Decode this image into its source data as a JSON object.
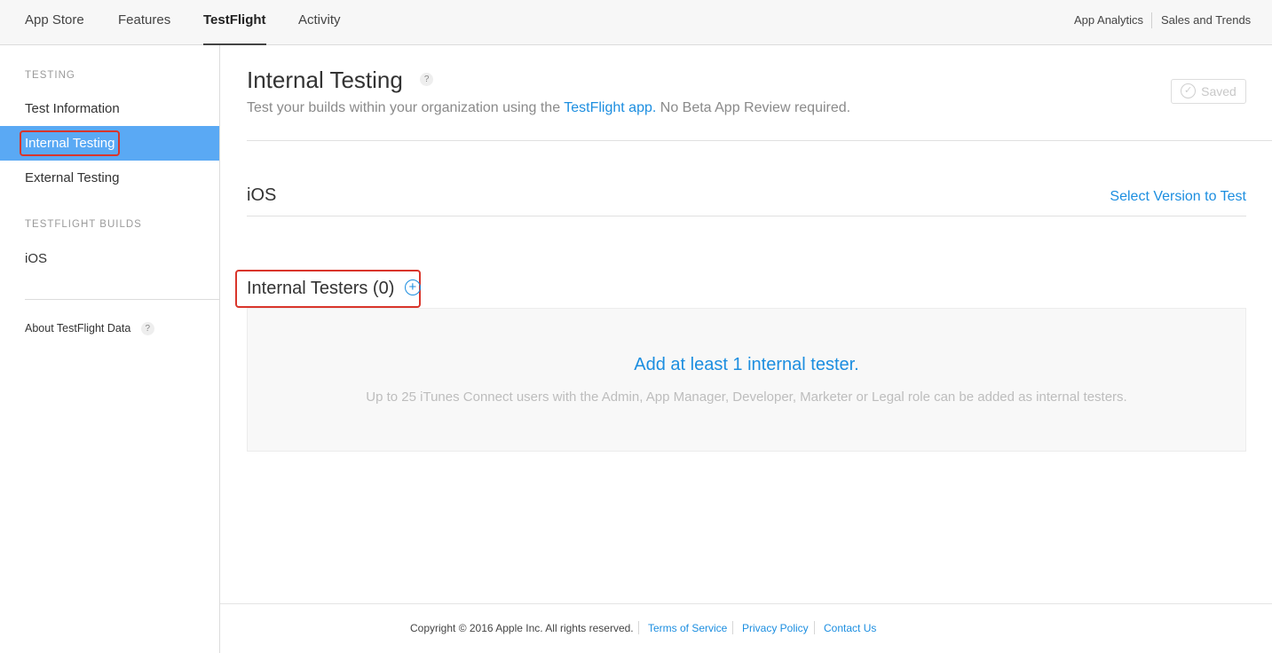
{
  "top_nav": {
    "tabs": [
      {
        "label": "App Store"
      },
      {
        "label": "Features"
      },
      {
        "label": "TestFlight",
        "active": true
      },
      {
        "label": "Activity"
      }
    ],
    "right_links": [
      {
        "label": "App Analytics"
      },
      {
        "label": "Sales and Trends"
      }
    ]
  },
  "sidebar": {
    "testing_header": "TESTING",
    "items": [
      {
        "label": "Test Information"
      },
      {
        "label": "Internal Testing",
        "active": true
      },
      {
        "label": "External Testing"
      }
    ],
    "builds_header": "TESTFLIGHT BUILDS",
    "build_items": [
      {
        "label": "iOS"
      }
    ],
    "about_label": "About TestFlight Data",
    "help_icon": "?"
  },
  "main": {
    "title": "Internal Testing",
    "help_icon": "?",
    "subtitle_prefix": "Test your builds within your organization using the ",
    "subtitle_link": "TestFlight app.",
    "subtitle_suffix": " No Beta App Review required.",
    "saved_label": "Saved",
    "platform_header": "iOS",
    "select_version_label": "Select Version to Test",
    "testers_title": "Internal Testers (0)",
    "add_icon": "+",
    "empty_title": "Add at least 1 internal tester.",
    "empty_description": "Up to 25 iTunes Connect users with the Admin, App Manager, Developer, Marketer or Legal role can be added as internal testers."
  },
  "footer": {
    "copyright": "Copyright © 2016 Apple Inc. All rights reserved.",
    "links": [
      {
        "label": "Terms of Service"
      },
      {
        "label": "Privacy Policy"
      },
      {
        "label": "Contact Us"
      }
    ]
  },
  "colors": {
    "accent": "#1c8ee0",
    "sidebar_active": "#5aa9f4",
    "highlight_box": "#d9352b"
  }
}
